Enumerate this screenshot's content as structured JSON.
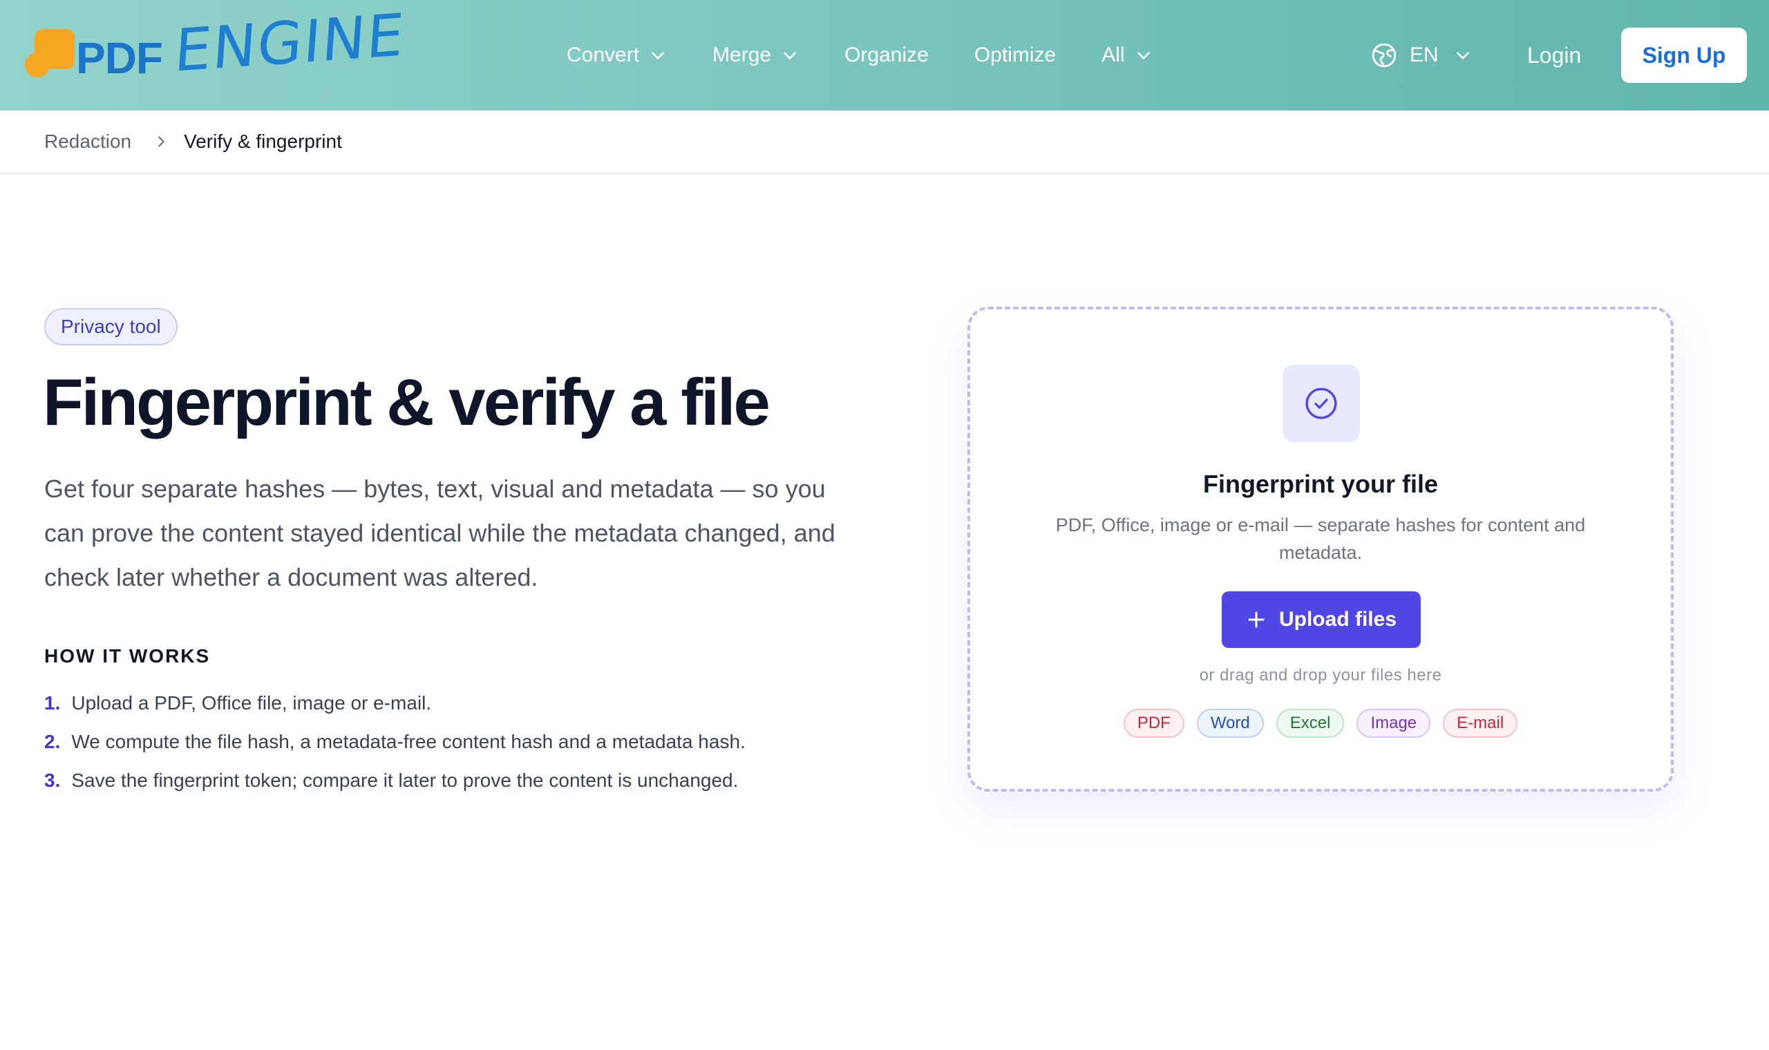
{
  "header": {
    "logo": {
      "pdf": "PDF",
      "engine": "ENGINE"
    },
    "nav": [
      {
        "label": "Convert",
        "dropdown": true
      },
      {
        "label": "Merge",
        "dropdown": true
      },
      {
        "label": "Organize",
        "dropdown": false
      },
      {
        "label": "Optimize",
        "dropdown": false
      },
      {
        "label": "All",
        "dropdown": true
      }
    ],
    "language": "EN",
    "login": "Login",
    "signup": "Sign Up"
  },
  "breadcrumb": {
    "parent": "Redaction",
    "current": "Verify & fingerprint"
  },
  "hero": {
    "badge": "Privacy tool",
    "title": "Fingerprint & verify a file",
    "description": "Get four separate hashes — bytes, text, visual and metadata — so you can prove the content stayed identical while the metadata changed, and check later whether a document was altered.",
    "how_title": "HOW IT WORKS",
    "steps": [
      {
        "num": "1.",
        "text": "Upload a PDF, Office file, image or e-mail."
      },
      {
        "num": "2.",
        "text": "We compute the file hash, a metadata-free content hash and a metadata hash."
      },
      {
        "num": "3.",
        "text": "Save the fingerprint token; compare it later to prove the content is unchanged."
      }
    ]
  },
  "upload": {
    "icon": "check-circle-icon",
    "title": "Fingerprint your file",
    "subtitle": "PDF, Office, image or e-mail — separate hashes for content and metadata.",
    "button": "Upload files",
    "drag_hint": "or drag and drop your files here",
    "formats": [
      {
        "label": "PDF",
        "color": "#c2283c",
        "bg": "#fdf1f2",
        "border": "#f5c2c8"
      },
      {
        "label": "Word",
        "color": "#1f4fb8",
        "bg": "#eef4fd",
        "border": "#bcd0f2"
      },
      {
        "label": "Excel",
        "color": "#1f7a3a",
        "bg": "#eefaf1",
        "border": "#bfe6c9"
      },
      {
        "label": "Image",
        "color": "#7a2fb8",
        "bg": "#f7f0fd",
        "border": "#dcc4f2"
      },
      {
        "label": "E-mail",
        "color": "#c2283c",
        "bg": "#fdf1f2",
        "border": "#f5c2c8"
      }
    ]
  },
  "colors": {
    "accent": "#4f46e5",
    "brand_blue": "#1a74c7",
    "logo_orange": "#f5a623"
  }
}
